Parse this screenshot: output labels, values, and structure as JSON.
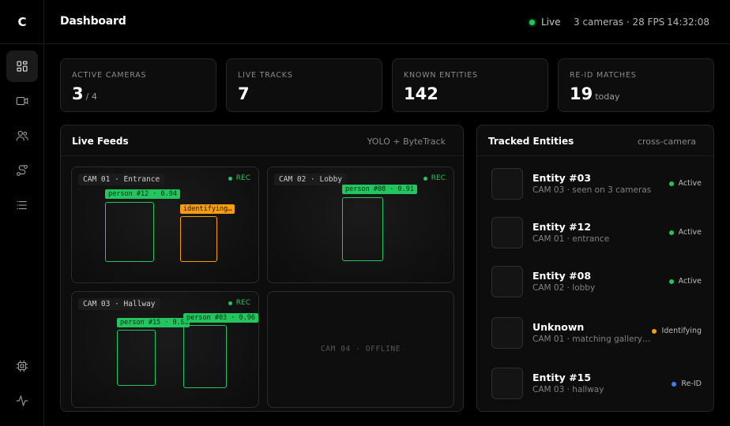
{
  "app": {
    "logo": "C"
  },
  "sidebar": {
    "items": [
      {
        "icon": "dashboard-icon",
        "active": true
      },
      {
        "icon": "camera-icon",
        "active": false
      },
      {
        "icon": "users-icon",
        "active": false
      },
      {
        "icon": "route-icon",
        "active": false
      },
      {
        "icon": "list-icon",
        "active": false
      },
      {
        "icon": "cpu-icon",
        "active": false
      },
      {
        "icon": "activity-icon",
        "active": false
      }
    ]
  },
  "header": {
    "title": "Dashboard",
    "live_label": "Live",
    "cameras_fps": "3 cameras · 28 FPS",
    "time": "14:32:08"
  },
  "stats": [
    {
      "label": "ACTIVE CAMERAS",
      "value": "3",
      "suffix": "/ 4"
    },
    {
      "label": "LIVE TRACKS",
      "value": "7",
      "suffix": ""
    },
    {
      "label": "KNOWN ENTITIES",
      "value": "142",
      "suffix": ""
    },
    {
      "label": "RE-ID MATCHES",
      "value": "19",
      "suffix": "today"
    }
  ],
  "feeds_panel": {
    "title": "Live Feeds",
    "meta": "YOLO + ByteTrack",
    "feeds": [
      {
        "label": "CAM 01 · Entrance",
        "rec": "REC",
        "tags": [
          "person #12 · 0.94",
          "identifying…"
        ]
      },
      {
        "label": "CAM 02 · Lobby",
        "rec": "REC",
        "tags": [
          "person #08 · 0.91"
        ]
      },
      {
        "label": "CAM 03 · Hallway",
        "rec": "REC",
        "tags": [
          "person #15 · 0.88",
          "person #03 · 0.96"
        ]
      },
      {
        "offline_text": "CAM 04 · OFFLINE"
      }
    ]
  },
  "entities_panel": {
    "title": "Tracked Entities",
    "meta": "cross-camera",
    "entities": [
      {
        "name": "Entity #03",
        "sub": "CAM 03 · seen on 3 cameras",
        "status": "Active",
        "status_color": "#22c55e"
      },
      {
        "name": "Entity #12",
        "sub": "CAM 01 · entrance",
        "status": "Active",
        "status_color": "#22c55e"
      },
      {
        "name": "Entity #08",
        "sub": "CAM 02 · lobby",
        "status": "Active",
        "status_color": "#22c55e"
      },
      {
        "name": "Unknown",
        "sub": "CAM 01 · matching gallery…",
        "status": "Identifying",
        "status_color": "#f59e0b"
      },
      {
        "name": "Entity #15",
        "sub": "CAM 03 · hallway",
        "status": "Re-ID",
        "status_color": "#3b82f6"
      }
    ]
  },
  "colors": {
    "accent_green": "#22c55e",
    "accent_orange": "#f59e0b",
    "accent_blue": "#3b82f6",
    "background": "#000000",
    "card": "#0d0d0d"
  }
}
